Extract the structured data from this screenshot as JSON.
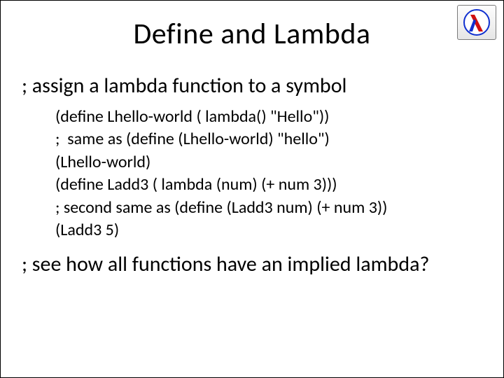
{
  "title": "Define and Lambda",
  "subtitle": "; assign a lambda function to a symbol",
  "code": {
    "l1": "(define Lhello-world ( lambda() \"Hello\"))",
    "l2": ";  same as (define (Lhello-world) \"hello\")",
    "l3": "(Lhello-world)",
    "l4": "(define Ladd3 ( lambda (num) (+ num 3)))",
    "l5": "; second same as (define (Ladd3 num) (+ num 3))",
    "l6": "(Ladd3 5)"
  },
  "footnote": "; see how all functions have an implied lambda?"
}
